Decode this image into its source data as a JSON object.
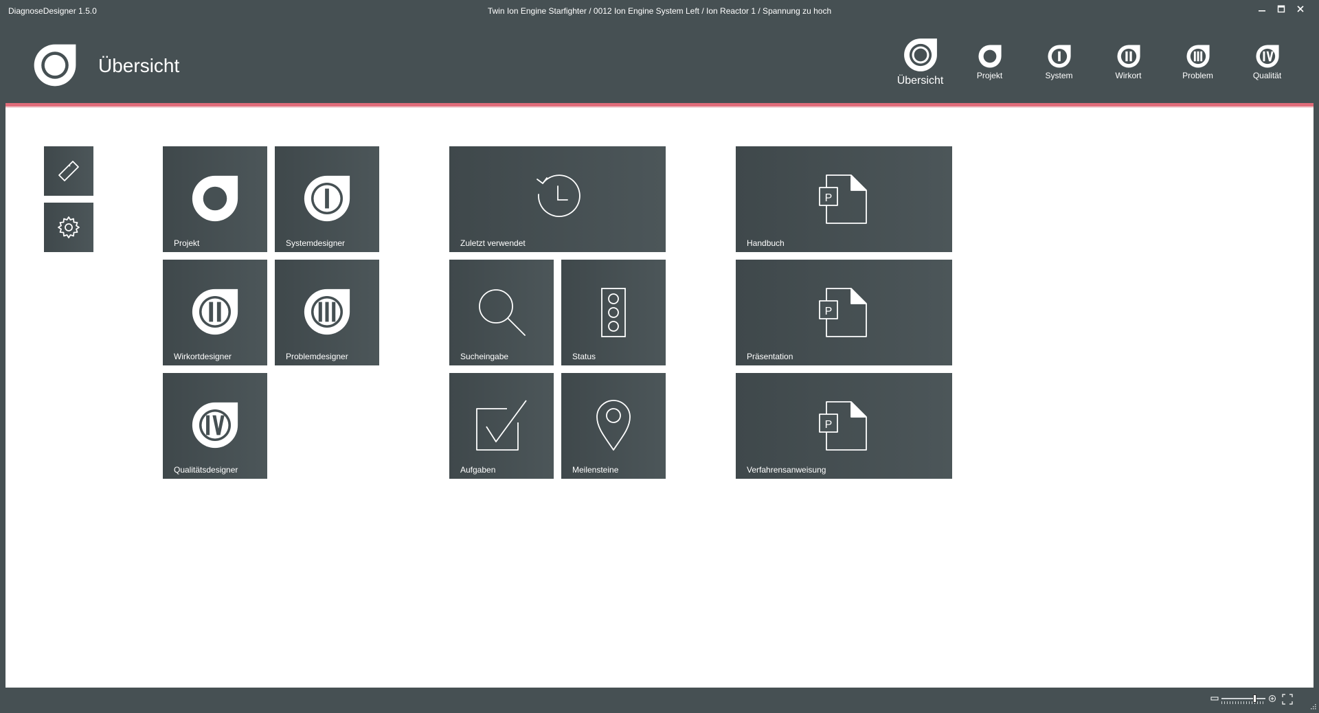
{
  "window": {
    "app_name": "DiagnoseDesigner 1.5.0",
    "breadcrumb": "Twin Ion Engine Starfighter / 0012 Ion Engine System Left / Ion Reactor 1 / Spannung zu hoch"
  },
  "header": {
    "title": "Übersicht"
  },
  "topnav": [
    {
      "label": "Übersicht",
      "numeral": "",
      "active": true
    },
    {
      "label": "Projekt",
      "numeral": "",
      "active": false
    },
    {
      "label": "System",
      "numeral": "I",
      "active": false
    },
    {
      "label": "Wirkort",
      "numeral": "II",
      "active": false
    },
    {
      "label": "Problem",
      "numeral": "III",
      "active": false
    },
    {
      "label": "Qualität",
      "numeral": "IV",
      "active": false
    }
  ],
  "tiles": {
    "designers": [
      {
        "label": "Projekt"
      },
      {
        "label": "Systemdesigner",
        "numeral": "I"
      },
      {
        "label": "Wirkortdesigner",
        "numeral": "II"
      },
      {
        "label": "Problemdesigner",
        "numeral": "III"
      },
      {
        "label": "Qualitätsdesigner",
        "numeral": "IV"
      }
    ],
    "tools": [
      {
        "label": "Zuletzt verwendet",
        "icon": "history-icon"
      },
      {
        "label": "Sucheingabe",
        "icon": "search-icon"
      },
      {
        "label": "Status",
        "icon": "traffic-light-icon"
      },
      {
        "label": "Aufgaben",
        "icon": "checkbox-icon"
      },
      {
        "label": "Meilensteine",
        "icon": "map-pin-icon"
      }
    ],
    "documents": [
      {
        "label": "Handbuch",
        "icon": "powerpoint-document-icon",
        "letter": "P"
      },
      {
        "label": "Präsentation",
        "icon": "powerpoint-document-icon",
        "letter": "P"
      },
      {
        "label": "Verfahrensanweisung",
        "icon": "powerpoint-document-icon",
        "letter": "P"
      }
    ]
  },
  "colors": {
    "chrome": "#465053",
    "tile": "#465053",
    "accent": "#e06c7a",
    "content_bg": "#ffffff"
  }
}
